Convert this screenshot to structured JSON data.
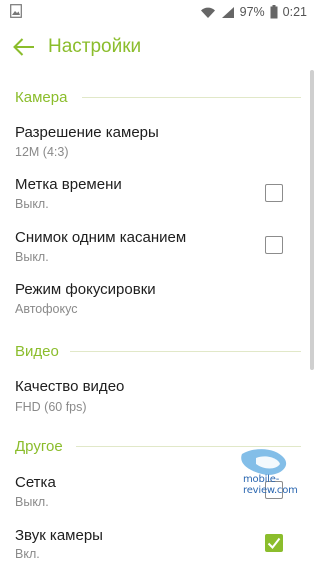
{
  "status_bar": {
    "battery_percent": "97%",
    "time": "0:21",
    "icons": [
      "image-icon",
      "wifi-icon",
      "signal-icon",
      "battery-icon"
    ]
  },
  "header": {
    "title": "Настройки",
    "back_icon": "back-arrow-icon"
  },
  "colors": {
    "accent": "#8bbd2c",
    "primary_text": "#1e1e1e",
    "secondary_text": "#8a8a8a",
    "divider": "#e1e8c8"
  },
  "sections": [
    {
      "title": "Камера",
      "items": [
        {
          "title": "Разрешение камеры",
          "value": "12M (4:3)",
          "control": "none"
        },
        {
          "title": "Метка времени",
          "value": "Выкл.",
          "control": "checkbox",
          "checked": false
        },
        {
          "title": "Снимок одним касанием",
          "value": "Выкл.",
          "control": "checkbox",
          "checked": false
        },
        {
          "title": "Режим фокусировки",
          "value": "Автофокус",
          "control": "none"
        }
      ]
    },
    {
      "title": "Видео",
      "items": [
        {
          "title": "Качество видео",
          "value": "FHD (60 fps)",
          "control": "none"
        }
      ]
    },
    {
      "title": "Другое",
      "items": [
        {
          "title": "Сетка",
          "value": "Выкл.",
          "control": "checkbox",
          "checked": false
        },
        {
          "title": "Звук камеры",
          "value": "Вкл.",
          "control": "checkbox",
          "checked": true
        }
      ]
    }
  ],
  "watermark": {
    "text": "mobile-review.com"
  }
}
